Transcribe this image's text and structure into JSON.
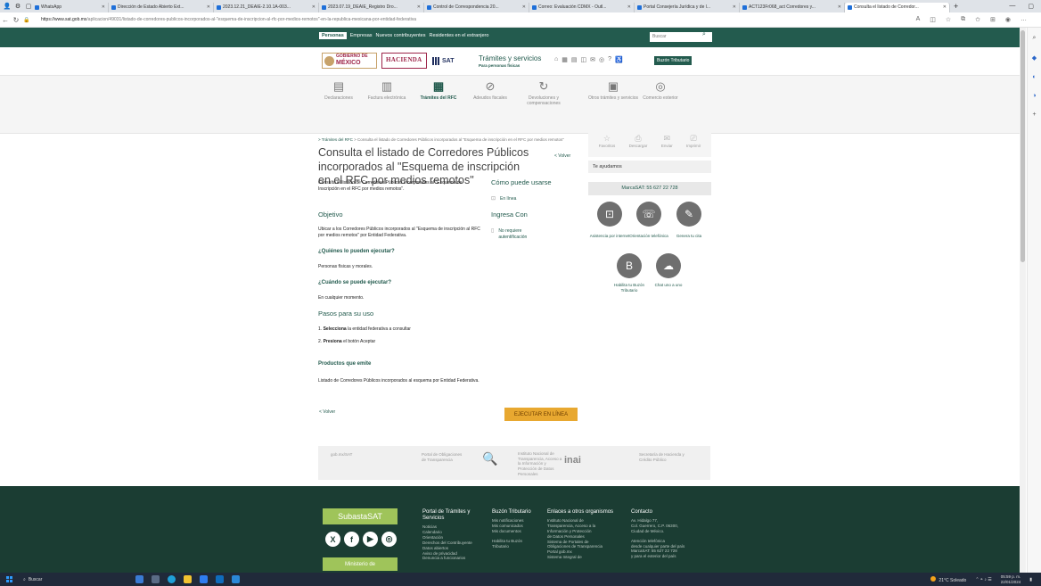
{
  "browser": {
    "tabs": [
      {
        "label": "WhatsApp",
        "active": false
      },
      {
        "label": "Dirección de Estado Abierto Ext...",
        "active": false
      },
      {
        "label": "2023.12.21_DEAIE-2.10.1A-003...",
        "active": false
      },
      {
        "label": "2023.07.19_DEAIE_Registro Dro...",
        "active": false
      },
      {
        "label": "Control de Correspondencia 20...",
        "active": false
      },
      {
        "label": "Correo: Evaluación CDMX - Outl...",
        "active": false
      },
      {
        "label": "Portal Consejería Jurídica y de l...",
        "active": false
      },
      {
        "label": "ACT123Fr068_act Corredores y...",
        "active": false
      },
      {
        "label": "Consulta el listado de Corredor...",
        "active": true
      }
    ],
    "url_domain": "https://www.sat.gob.mx",
    "url_path": "/aplicacion/49031/listado-de-corredores-publicos-incorporados-al-\"esquema-de-inscripcion-al-rfc-por-medios-remotos\"-en-la-republica-mexicana-por-entidad-federativa"
  },
  "gov_nav": {
    "items": [
      "Personas",
      "Empresas",
      "Nuevos contribuyentes",
      "Residentes en el extranjero"
    ],
    "search_placeholder": "Buscar"
  },
  "brand": {
    "gobierno": "GOBIERNO DE",
    "mexico": "MÉXICO",
    "hacienda": "HACIENDA",
    "sat": "SAT",
    "tramites_title": "Trámites y servicios",
    "tramites_sub": "Para personas físicas",
    "buzon_btn": "Buzón Tributario"
  },
  "menu": [
    {
      "label": "Declaraciones",
      "icon": "declaraciones-icon",
      "glyph": "▤",
      "active": false
    },
    {
      "label": "Factura electrónica",
      "icon": "factura-icon",
      "glyph": "▥",
      "active": false
    },
    {
      "label": "Trámites del RFC",
      "icon": "rfc-icon",
      "glyph": "▦",
      "active": true
    },
    {
      "label": "Adeudos fiscales",
      "icon": "adeudos-icon",
      "glyph": "⊘",
      "active": false
    },
    {
      "label": "Devoluciones y compensaciones",
      "icon": "devoluciones-icon",
      "glyph": "↻",
      "active": false
    },
    {
      "label": "Otros trámites y servicios",
      "icon": "otros-icon",
      "glyph": "▣",
      "active": false
    },
    {
      "label": "Comercio exterior",
      "icon": "comercio-icon",
      "glyph": "◎",
      "active": false
    }
  ],
  "breadcrumb": {
    "parent": "> Trámites del RFC",
    "current": " > Consulta el listado de Corredores Públicos incorporados al \"Esquema de inscripción en el RFC por medios remotos\""
  },
  "content": {
    "title": "Consulta el listado de Corredores Públicos incorporados al \"Esquema de inscripción en el RFC por medios remotos\"",
    "volver": "< Volver",
    "description": "Consulta el listado de Corredores Públicos incorporados al \"Esquema de Inscripción en el RFC por medios remotos\".",
    "como_usarse": "Cómo puede usarse",
    "en_linea": "En línea",
    "objetivo_h": "Objetivo",
    "objetivo_text": "Ubicar a los Corredores Públicos incorporados al \"Esquema de inscripción al RFC por medios remotos\" por Entidad Federativa.",
    "ingresa_con": "Ingresa Con",
    "no_requiere": "No requiere autentificación",
    "quienes_h": "¿Quiénes lo pueden ejecutar?",
    "quienes_text": "Personas físicas y morales.",
    "cuando_h": "¿Cuándo se puede ejecutar?",
    "cuando_text": "En cualquier momento.",
    "pasos_h": "Pasos para su uso",
    "step1_num": "1.",
    "step1_bold": "Selecciona",
    "step1_rest": " la entidad federativa a consultar",
    "step2_num": "2.",
    "step2_bold": "Presiona",
    "step2_rest": " el botón Aceptar",
    "productos_h": "Productos que emite",
    "productos_text": "Listado de Corredores Públicos incorporados al esquema por Entidad Federativa.",
    "volver_bottom": "< Volver",
    "ejecutar": "EJECUTAR EN LÍNEA"
  },
  "side": {
    "share": [
      {
        "label": "Favoritos",
        "glyph": "☆"
      },
      {
        "label": "Descargar",
        "glyph": "⎙"
      },
      {
        "label": "Enviar",
        "glyph": "✉"
      },
      {
        "label": "Imprimir",
        "glyph": "⎚"
      }
    ],
    "te_ayudamos": "Te ayudamos",
    "marcasat": "MarcaSAT: 55 627 22 728",
    "help1": "Asistencia por internet",
    "help2": "Orientación telefónica",
    "help3": "Genera tu cita",
    "help4": "Habilita tu Buzón Tributario",
    "help5": "Chat uno a uno"
  },
  "logos_row": {
    "gobmx": "gob.mx/SAT",
    "portal_obligaciones": "Portal de Obligaciones de Transparencia",
    "inai_text": "Instituto Nacional de Transparencia, Acceso a la Información y Protección de Datos Personales",
    "inai_mark": "inai",
    "shcp": "Secretaría de Hacienda y Crédito Público"
  },
  "footer": {
    "subasta": "SubastaSAT",
    "ministerio": "Ministerio de",
    "col1_h": "Portal de Trámites y Servicios",
    "col1_items": [
      "Noticias",
      "Calendario",
      "Orientación",
      "Derechos del Contribuyente",
      "Datos abiertos",
      "Aviso de privacidad",
      "Denuncia a funcionarios"
    ],
    "col2_h": "Buzón Tributario",
    "col2_items": [
      "Mis notificaciones",
      "Mis comunicados",
      "Mis documentos",
      "",
      "Habilita tu Buzón",
      "Tributario"
    ],
    "col3_h": "Enlaces a otros organismos",
    "col3_items": [
      "Instituto Nacional de",
      "Transparencia, Acceso a la",
      "Información y Protección",
      "de Datos Personales",
      "Sistema de Portales de",
      "Obligaciones de Transparencia",
      "Portal gob.mx",
      "Sistema Integral de"
    ],
    "col4_h": "Contacto",
    "col4_items": [
      "Av. Hidalgo 77,",
      "Col. Guerrero, C.P. 06300,",
      "Ciudad de México.",
      "",
      "Atención telefónica",
      "desde cualquier parte del país",
      "MarcaSAT: 55 627 22 728",
      "y para el exterior del país"
    ]
  },
  "taskbar": {
    "search": "Buscar",
    "weather": "21°C Soleado",
    "time": "05:59 p. m.",
    "date": "22/01/2024"
  }
}
